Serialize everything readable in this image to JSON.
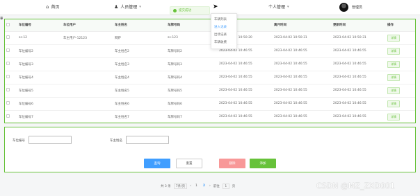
{
  "header": {
    "home_icon": "home-icon",
    "home_label": "首页",
    "person_menu_label": "人员管理",
    "personal_menu_label": "个人管理",
    "user_name": "管理员"
  },
  "toast": {
    "text": "提交成功"
  },
  "dropdown": {
    "items": [
      "车辆列表",
      "进入记录",
      "出场记录",
      "车辆收费"
    ]
  },
  "table": {
    "columns": [
      "车位编号",
      "车位用户",
      "车主姓名",
      "车牌号码",
      "进入时间",
      "离开时间",
      "更新时间",
      "操作"
    ],
    "rows": [
      [
        "ss-12",
        "车主用户-12123",
        "网萨",
        "ss-123",
        "2023-04-02 10:50:20",
        "2023-04-02 10:50:31",
        "2023-04-02 10:50:31",
        "详情"
      ],
      [
        "车位编号2",
        "",
        "车主姓名2",
        "车牌号码2",
        "2023-04-02 10:46:55",
        "2023-04-02 10:46:55",
        "2023-04-02 10:46:55",
        "详情"
      ],
      [
        "车位编号3",
        "",
        "车主姓名3",
        "车牌号码3",
        "2023-04-02 10:46:55",
        "2023-04-02 10:46:55",
        "2023-04-02 10:46:55",
        "详情"
      ],
      [
        "车位编号4",
        "",
        "车主姓名4",
        "车牌号码4",
        "2023-04-02 10:46:55",
        "2023-04-02 10:46:55",
        "2023-04-02 10:46:55",
        "详情"
      ],
      [
        "车位编号5",
        "",
        "车主姓名5",
        "车牌号码5",
        "2023-04-02 10:46:55",
        "2023-04-02 10:46:55",
        "2023-04-02 10:46:55",
        "详情"
      ],
      [
        "车位编号6",
        "",
        "车主姓名6",
        "车牌号码6",
        "2023-04-02 10:46:55",
        "2023-04-02 10:46:55",
        "2023-04-02 10:46:55",
        "详情"
      ],
      [
        "车位编号7",
        "",
        "车主姓名7",
        "车牌号码7",
        "2023-04-02 10:46:55",
        "2023-04-02 10:46:55",
        "2023-04-02 10:46:55",
        "详情"
      ]
    ]
  },
  "search": {
    "spot_label": "车位编号",
    "spot_value": "",
    "owner_label": "车主姓名",
    "owner_value": "",
    "query_button": "查询",
    "reset_button": "重置",
    "delete_button": "删除",
    "add_button": "添加"
  },
  "pagination": {
    "total_text": "共 3 条",
    "page_size": "7条/页",
    "pages": [
      "1",
      "2"
    ],
    "active_page": "2",
    "goto_label": "前往",
    "goto_value": "1",
    "page_unit": "页"
  },
  "watermark": "CSDN @MZ_ZXD001",
  "colors": {
    "accent": "#67c23a",
    "primary": "#409eff",
    "danger": "#f56c6c"
  }
}
